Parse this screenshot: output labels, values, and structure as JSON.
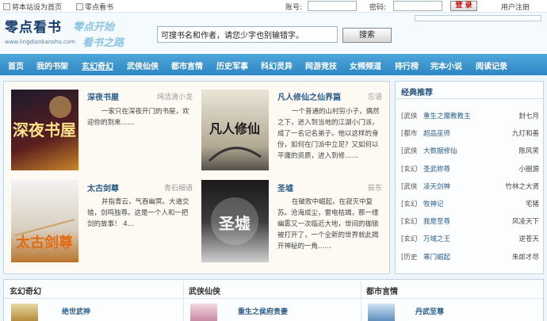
{
  "topbar": {
    "set_home": "将本站设为首页",
    "bookmark": "零点看书",
    "account_label": "账号:",
    "password_label": "密码:",
    "login_button": "登 录",
    "register": "用户注册"
  },
  "header": {
    "logo": "零点看书",
    "logo_url": "www.lingdiankanshu.com",
    "slogan_line1": "零点开始",
    "slogan_line2": "看书之路",
    "search_placeholder": "可搜书名和作者，请您少字也别输错字。",
    "search_button": "搜索"
  },
  "nav": {
    "items": [
      "首页",
      "我的书架",
      "玄幻奇幻",
      "武侠仙侠",
      "都市言情",
      "历史军事",
      "科幻灵异",
      "网游竞技",
      "女频频道",
      "排行榜",
      "完本小说",
      "阅读记录"
    ],
    "active": "玄幻奇幻"
  },
  "featured": [
    {
      "title": "深夜书屋",
      "author": "纯洁滴小龙",
      "desc": "一家只在深夜开门的书屋，欢迎你的到来……",
      "cover_text": "深夜书屋"
    },
    {
      "title": "凡人修仙之仙界篇",
      "author": "忘语",
      "desc": "一个普通的山村穷小子，偶然之下，进入到当地的江湖小门派，成了一名记名弟子。他以这样的身份，如何在门派中立足？又如何以平庸的资质，进入到修……",
      "cover_text": "凡人修仙"
    },
    {
      "title": "太古剑尊",
      "author": "青石细语",
      "desc": "并指青云，气吞幽冥。大道交错，剑鸣独尊。这是一个人和一把剑的故事！ 4…",
      "cover_text": "太古剑尊"
    },
    {
      "title": "圣墟",
      "author": "辰东",
      "desc": "在破败中崛起，在寂灭中复苏。沧海成尘，雷电枯竭，那一缕幽雾又一次临近大地，世间的枷锁被打开了，一个全新的世界就此揭开神秘的一角……",
      "cover_text": "圣墟"
    }
  ],
  "recommend": {
    "title": "经典推荐",
    "items": [
      {
        "cat": "[武侠",
        "name": "重生之魔教教主",
        "author": "封七月"
      },
      {
        "cat": "[都市",
        "name": "超品巫师",
        "author": "九灯和善"
      },
      {
        "cat": "[武侠",
        "name": "大数据修仙",
        "author": "陈风笑"
      },
      {
        "cat": "[玄幻",
        "name": "圣武称尊",
        "author": "小圈源"
      },
      {
        "cat": "[武侠",
        "name": "凌天剑神",
        "author": "竹林之大贤"
      },
      {
        "cat": "[玄幻",
        "name": "牧神记",
        "author": "宅猪"
      },
      {
        "cat": "[玄幻",
        "name": "我是至尊",
        "author": "风凌天下"
      },
      {
        "cat": "[玄幻",
        "name": "万域之王",
        "author": "逆苍天"
      },
      {
        "cat": "[历史",
        "name": "寒门崛起",
        "author": "朱郎才尽"
      }
    ]
  },
  "sections": [
    {
      "title": "玄幻奇幻",
      "book": "绝世武神"
    },
    {
      "title": "武侠仙侠",
      "book": "重生之侯府贵妻"
    },
    {
      "title": "都市言情",
      "book": "丹武至尊"
    }
  ]
}
